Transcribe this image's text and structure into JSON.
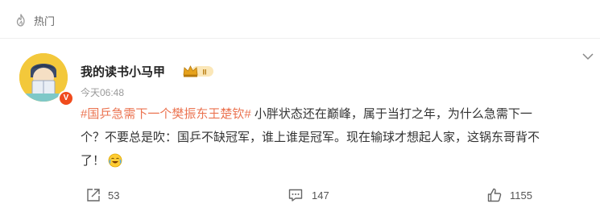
{
  "header": {
    "title": "热门",
    "icon": "fire-icon"
  },
  "post": {
    "author": "我的读书小马甲",
    "verified_badge": "V",
    "member_badge_text": "II",
    "timestamp": "今天06:48",
    "hashtag": "#国乒急需下一个樊振东王楚钦#",
    "body_line1": " 小胖状态还在巅峰，属于当打之年，为什么急需下一",
    "body_line2": "个？不要总是吹：国乒不缺冠军，谁上谁是冠军。现在输球才想起人家，这锅东哥背不",
    "body_line3": "了！",
    "emoji": "crying-laughing-emoji"
  },
  "actions": {
    "share_count": "53",
    "comment_count": "147",
    "like_count": "1155"
  },
  "colors": {
    "hashtag": "#eb7350",
    "accent": "#f04b1c",
    "avatar_bg": "#f3c83b"
  }
}
